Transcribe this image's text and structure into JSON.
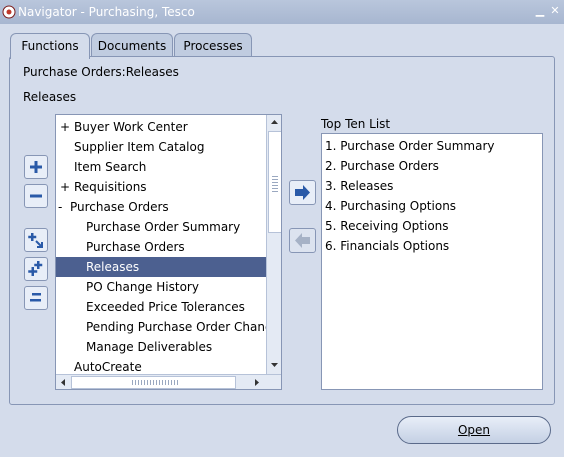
{
  "window": {
    "title": "Navigator - Purchasing, Tesco"
  },
  "tabs": [
    {
      "label": "Functions",
      "active": true
    },
    {
      "label": "Documents",
      "active": false
    },
    {
      "label": "Processes",
      "active": false
    }
  ],
  "breadcrumb": "Purchase Orders:Releases",
  "current_label": "Releases",
  "tree": [
    {
      "prefix": "+",
      "label": "Buyer Work Center"
    },
    {
      "prefix": "",
      "label": "Supplier Item Catalog"
    },
    {
      "prefix": "",
      "label": "Item Search"
    },
    {
      "prefix": "+",
      "label": "Requisitions"
    },
    {
      "prefix": "-",
      "label": "Purchase Orders"
    },
    {
      "prefix": "",
      "label": "Purchase Order Summary"
    },
    {
      "prefix": "",
      "label": "Purchase Orders"
    },
    {
      "prefix": "",
      "label": "Releases",
      "selected": true
    },
    {
      "prefix": "",
      "label": "PO Change History"
    },
    {
      "prefix": "",
      "label": "Exceeded Price Tolerances"
    },
    {
      "prefix": "",
      "label": "Pending Purchase Order Changes"
    },
    {
      "prefix": "",
      "label": "Manage Deliverables"
    },
    {
      "prefix": "",
      "label": "AutoCreate"
    }
  ],
  "top_ten": {
    "heading": "Top Ten List",
    "items": [
      "1. Purchase Order Summary",
      "2. Purchase Orders",
      "3. Releases",
      "4. Purchasing Options",
      "5. Receiving Options",
      "6. Financials Options"
    ]
  },
  "buttons": {
    "open": "Open"
  },
  "colors": {
    "selection": "#4c6090",
    "background": "#d4dceb",
    "titlebar": "#a7b6d0",
    "icon_blue": "#2a5aa8"
  }
}
